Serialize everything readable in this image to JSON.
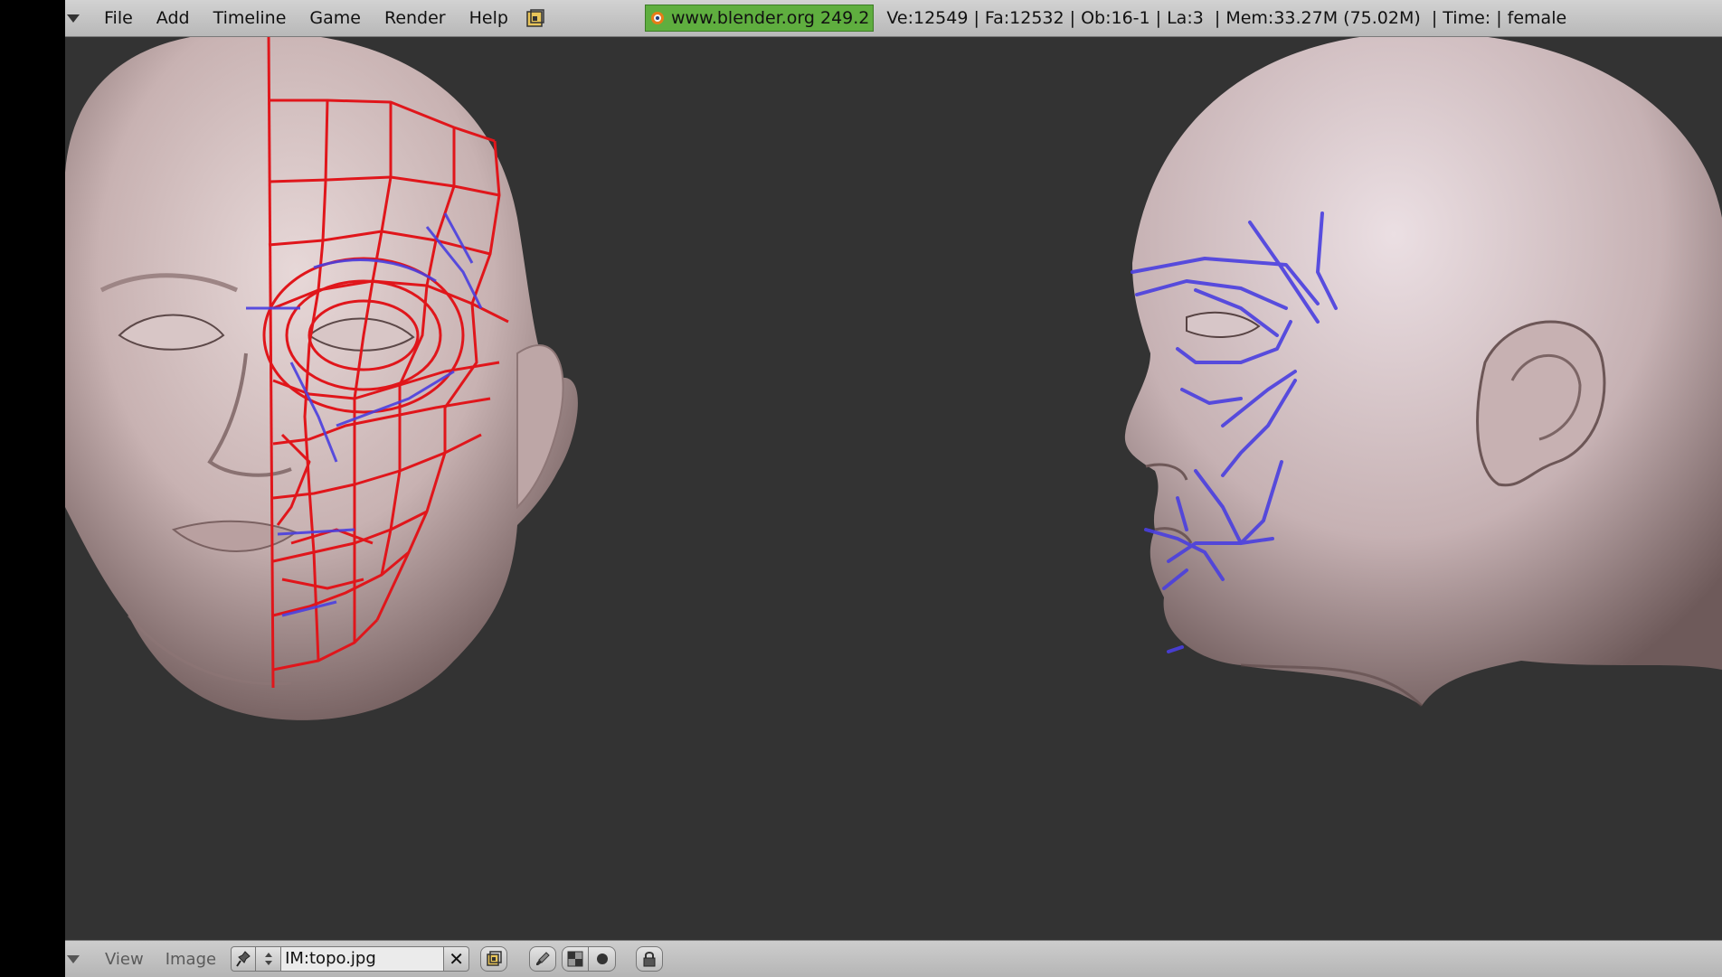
{
  "window": {
    "menu": [
      "File",
      "Add",
      "Timeline",
      "Game",
      "Render",
      "Help"
    ],
    "url_badge": "www.blender.org 249.2",
    "stats": "Ve:12549 | Fa:12532 | Ob:16-1 | La:3  | Mem:33.27M (75.02M)  | Time: | female"
  },
  "image_editor": {
    "menu": [
      "View",
      "Image"
    ],
    "image_name": "IM:topo.jpg",
    "close_symbol": "✕"
  },
  "icons": {
    "top_menu_toggle": "triangle-down-icon",
    "blender_logo": "blender-logo-icon",
    "pin": "pin-icon",
    "browse": "up-down-arrows-icon",
    "render": "render-icon",
    "paint": "brush-icon",
    "alpha": "alpha-icon",
    "draw": "circle-dot-icon",
    "lock": "lock-icon"
  },
  "colors": {
    "background": "#333333",
    "header": "#c4c4c4",
    "url_badge": "#5fae3f",
    "topology_red": "#e0161b",
    "topology_blue": "#4a3fe0",
    "skin": "#cdb9b9"
  }
}
